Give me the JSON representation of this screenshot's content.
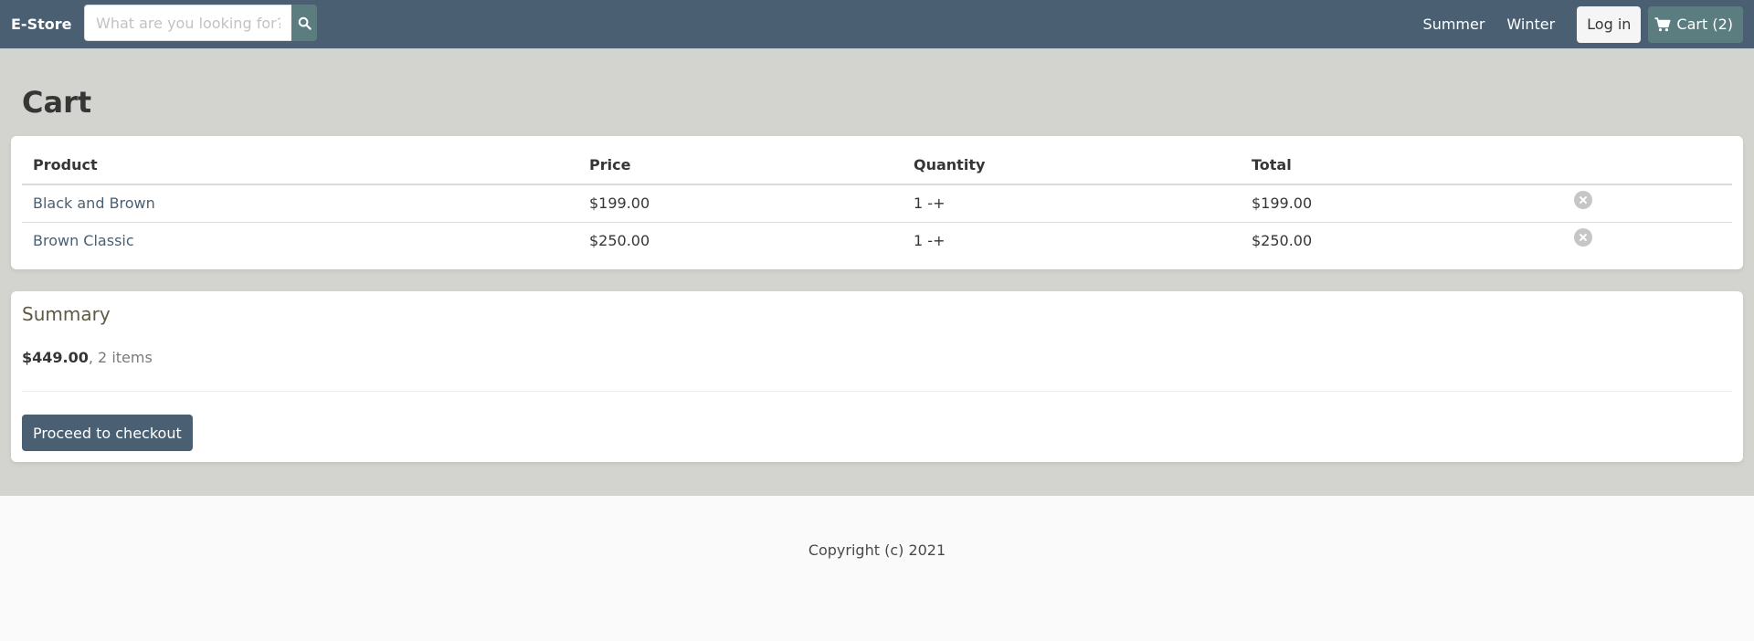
{
  "navbar": {
    "brand": "E-Store",
    "search": {
      "placeholder": "What are you looking for?",
      "value": ""
    },
    "links": [
      "Summer",
      "Winter"
    ],
    "login_label": "Log in",
    "cart_label": "Cart (2)"
  },
  "cart": {
    "title": "Cart",
    "columns": [
      "Product",
      "Price",
      "Quantity",
      "Total"
    ],
    "items": [
      {
        "product": "Black and Brown",
        "price": "$199.00",
        "quantity": "1",
        "decrement": "-",
        "increment": "+",
        "total": "$199.00"
      },
      {
        "product": "Brown Classic",
        "price": "$250.00",
        "quantity": "1",
        "decrement": "-",
        "increment": "+",
        "total": "$250.00"
      }
    ]
  },
  "summary": {
    "title": "Summary",
    "total": "$449.00",
    "items_text": ", 2 items",
    "checkout_label": "Proceed to checkout"
  },
  "footer": {
    "copyright": "Copyright (c) 2021"
  },
  "colors": {
    "navbar": "#4a6072",
    "accent": "#5b7d80",
    "main_bg": "#d3d3cf",
    "link": "#4a6072"
  }
}
